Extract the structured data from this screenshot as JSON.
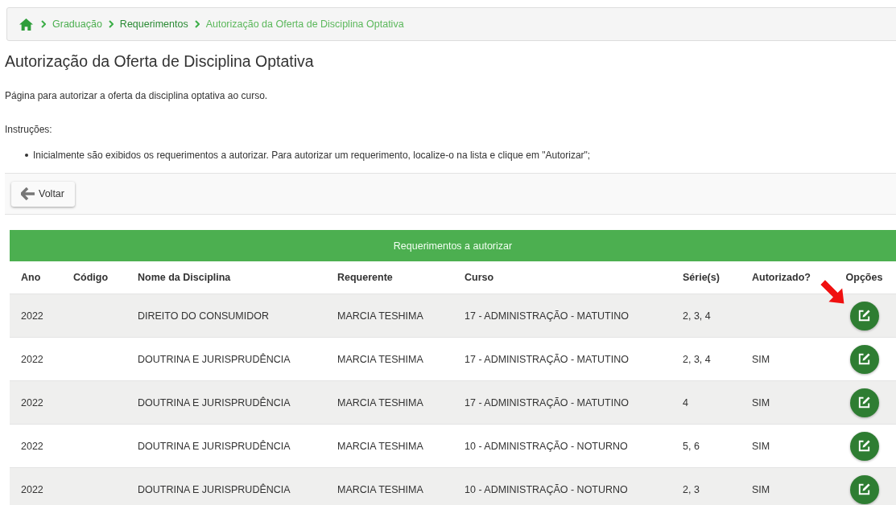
{
  "breadcrumb": [
    {
      "label": "Graduação",
      "current": false,
      "strong": false
    },
    {
      "label": "Requerimentos",
      "current": false,
      "strong": true
    },
    {
      "label": "Autorização da Oferta de Disciplina Optativa",
      "current": true,
      "strong": false
    }
  ],
  "title": "Autorização da Oferta de Disciplina Optativa",
  "description": "Página para autorizar a oferta da disciplina optativa ao curso.",
  "instructions_label": "Instruções:",
  "instructions": [
    "Inicialmente são exibidos os requerimentos a autorizar. Para autorizar um requerimento, localize-o na lista e clique em \"Autorizar\";"
  ],
  "back_button": "Voltar",
  "table": {
    "title": "Requerimentos a autorizar",
    "columns": [
      "Ano",
      "Código",
      "Nome da Disciplina",
      "Requerente",
      "Curso",
      "Série(s)",
      "Autorizado?",
      "Opções"
    ],
    "rows": [
      {
        "cells": [
          "2022",
          "",
          "DIREITO DO CONSUMIDOR",
          "MARCIA TESHIMA",
          "17 - ADMINISTRAÇÃO - MATUTINO",
          "2, 3, 4",
          ""
        ],
        "highlighted": true
      },
      {
        "cells": [
          "2022",
          "",
          "DOUTRINA E JURISPRUDÊNCIA",
          "MARCIA TESHIMA",
          "17 - ADMINISTRAÇÃO - MATUTINO",
          "2, 3, 4",
          "SIM"
        ],
        "highlighted": false
      },
      {
        "cells": [
          "2022",
          "",
          "DOUTRINA E JURISPRUDÊNCIA",
          "MARCIA TESHIMA",
          "17 - ADMINISTRAÇÃO - MATUTINO",
          "4",
          "SIM"
        ],
        "highlighted": false
      },
      {
        "cells": [
          "2022",
          "",
          "DOUTRINA E JURISPRUDÊNCIA",
          "MARCIA TESHIMA",
          "10 - ADMINISTRAÇÃO - NOTURNO",
          "5, 6",
          "SIM"
        ],
        "highlighted": false
      },
      {
        "cells": [
          "2022",
          "",
          "DOUTRINA E JURISPRUDÊNCIA",
          "MARCIA TESHIMA",
          "10 - ADMINISTRAÇÃO - NOTURNO",
          "2, 3",
          "SIM"
        ],
        "highlighted": false
      }
    ]
  }
}
